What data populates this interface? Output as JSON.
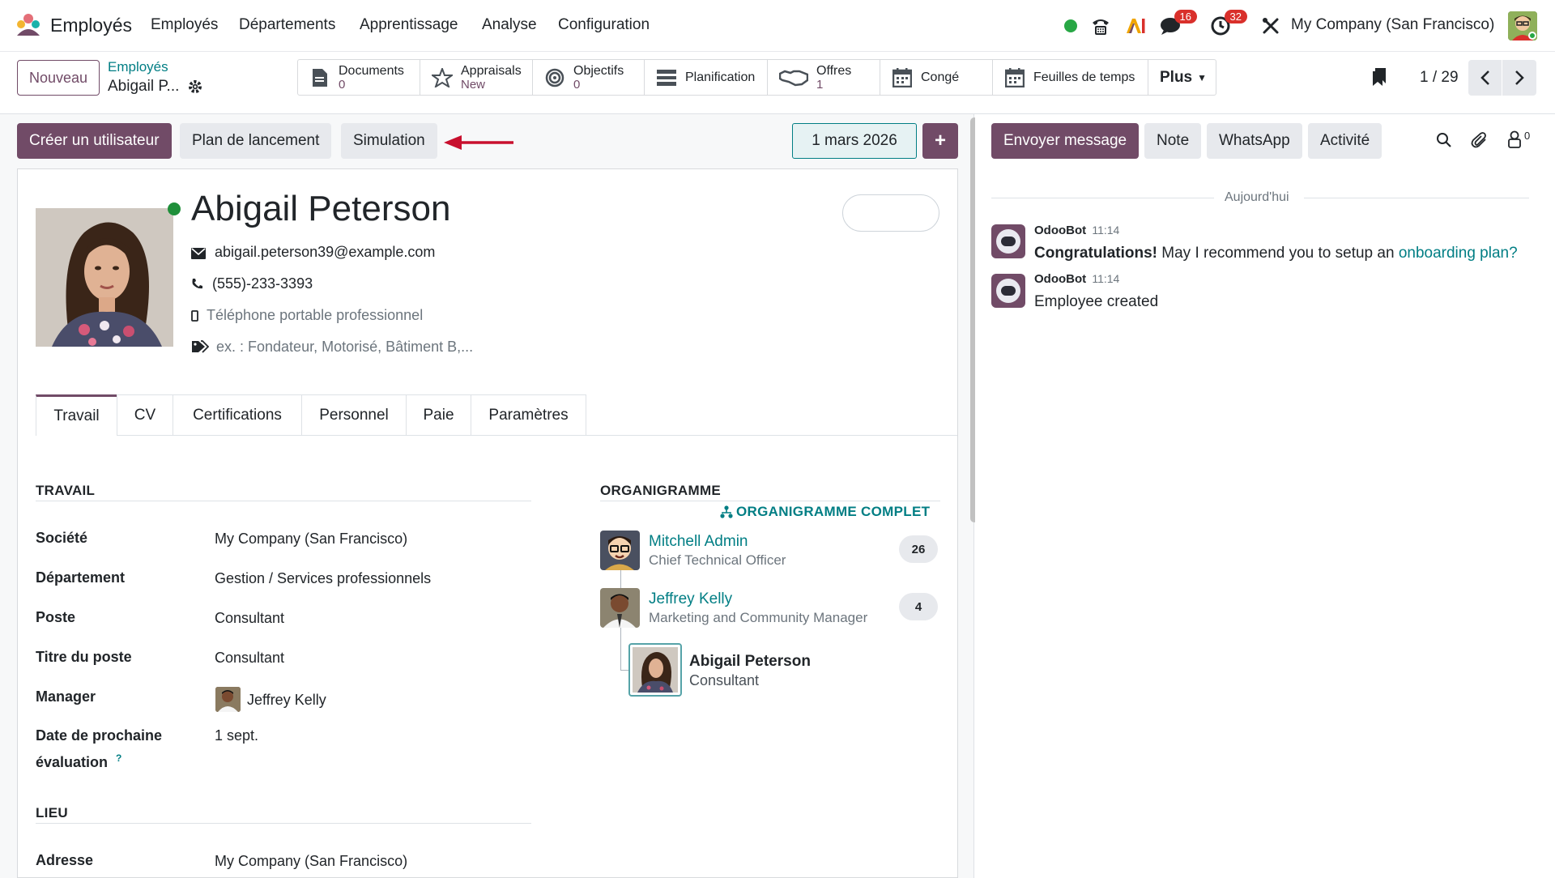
{
  "topnav": {
    "app_name": "Employés",
    "menu": [
      "Employés",
      "Départements",
      "Apprentissage",
      "Analyse",
      "Configuration"
    ],
    "messages_badge": "16",
    "activities_badge": "32",
    "company": "My Company (San Francisco)"
  },
  "control": {
    "new_label": "Nouveau",
    "breadcrumb_parent": "Employés",
    "breadcrumb_current": "Abigail P...",
    "smart_buttons": [
      {
        "label": "Documents",
        "value": "0",
        "icon": "document-icon"
      },
      {
        "label": "Appraisals",
        "value": "New",
        "icon": "star-icon"
      },
      {
        "label": "Objectifs",
        "value": "0",
        "icon": "target-icon"
      },
      {
        "label": "Planification",
        "value": "",
        "icon": "planning-icon"
      },
      {
        "label": "Offres",
        "value": "1",
        "icon": "handshake-icon"
      },
      {
        "label": "Congé",
        "value": "",
        "icon": "calendar-icon"
      },
      {
        "label": "Feuilles de temps",
        "value": "",
        "icon": "calendar-icon"
      }
    ],
    "more_label": "Plus",
    "pager": "1 / 29"
  },
  "actions": {
    "create_user": "Créer un utilisateur",
    "launch_plan": "Plan de lancement",
    "simulation": "Simulation",
    "date": "1 mars 2026",
    "add": "+"
  },
  "employee": {
    "name": "Abigail Peterson",
    "email": "abigail.peterson39@example.com",
    "phone": "(555)-233-3393",
    "mobile_placeholder": "Téléphone portable professionnel",
    "tags_placeholder": "ex. : Fondateur, Motorisé, Bâtiment B,..."
  },
  "tabs": [
    "Travail",
    "CV",
    "Certifications",
    "Personnel",
    "Paie",
    "Paramètres"
  ],
  "work": {
    "section_title": "TRAVAIL",
    "fields": [
      {
        "label": "Société",
        "value": "My Company (San Francisco)"
      },
      {
        "label": "Département",
        "value": "Gestion / Services professionnels"
      },
      {
        "label": "Poste",
        "value": "Consultant"
      },
      {
        "label": "Titre du poste",
        "value": "Consultant"
      },
      {
        "label": "Manager",
        "value": "Jeffrey Kelly"
      },
      {
        "label": "Date de prochaine évaluation",
        "value": "1 sept."
      }
    ],
    "help_mark": "?",
    "location_title": "LIEU",
    "address_label": "Adresse",
    "address_value": "My Company (San Francisco)"
  },
  "orgchart": {
    "title": "ORGANIGRAMME",
    "full_link": "ORGANIGRAMME COMPLET",
    "people": [
      {
        "name": "Mitchell Admin",
        "role": "Chief Technical Officer",
        "count": "26"
      },
      {
        "name": "Jeffrey Kelly",
        "role": "Marketing and Community Manager",
        "count": "4"
      },
      {
        "name": "Abigail Peterson",
        "role": "Consultant",
        "count": ""
      }
    ]
  },
  "chatter": {
    "send_message": "Envoyer message",
    "note": "Note",
    "whatsapp": "WhatsApp",
    "activity": "Activité",
    "followers": "0",
    "today": "Aujourd'hui",
    "messages": [
      {
        "author": "OdooBot",
        "time": "11:14",
        "bold": "Congratulations!",
        "text": " May I recommend you to setup an ",
        "link": "onboarding plan?"
      },
      {
        "author": "OdooBot",
        "time": "11:14",
        "bold": "",
        "text": "Employee created",
        "link": ""
      }
    ]
  },
  "colors": {
    "brand": "#714b67",
    "link": "#017e84",
    "online": "#28a745",
    "badge": "#d9302b",
    "arrow": "#c8102e"
  }
}
